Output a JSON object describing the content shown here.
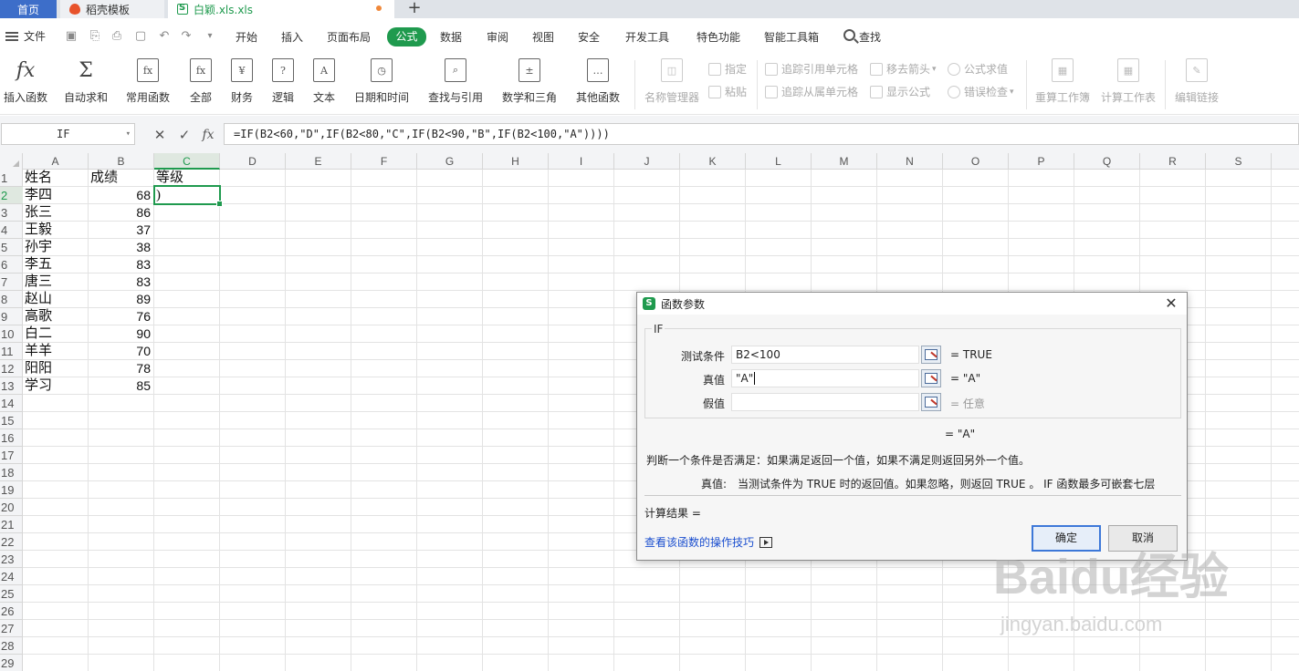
{
  "tabs": {
    "home": "首页",
    "docer": "稻壳模板",
    "file": "白颖.xls.xls",
    "add": "+"
  },
  "menu": {
    "file": "文件",
    "items": [
      "开始",
      "插入",
      "页面布局",
      "公式",
      "数据",
      "审阅",
      "视图",
      "安全",
      "开发工具",
      "特色功能",
      "智能工具箱",
      "查找"
    ],
    "active_index": 3
  },
  "ribbon": {
    "buttons": [
      "插入函数",
      "自动求和",
      "常用函数",
      "全部",
      "财务",
      "逻辑",
      "文本",
      "日期和时间",
      "查找与引用",
      "数学和三角",
      "其他函数",
      "名称管理器",
      "重算工作簿",
      "计算工作表",
      "编辑链接"
    ],
    "small": [
      "指定",
      "粘贴",
      "追踪引用单元格",
      "追踪从属单元格",
      "移去箭头",
      "显示公式",
      "公式求值",
      "错误检查"
    ],
    "icon_glyphs": {
      "insert_fn": "fx",
      "autosum": "Σ",
      "finance": "¥",
      "logic": "?",
      "text": "A"
    }
  },
  "formula_bar": {
    "name_box": "IF",
    "cancel_glyph": "✕",
    "confirm_glyph": "✓",
    "fx_glyph": "fx",
    "formula": "=IF(B2<60,\"D\",IF(B2<80,\"C\",IF(B2<90,\"B\",IF(B2<100,\"A\"))))"
  },
  "sheet": {
    "columns": [
      "A",
      "B",
      "C",
      "D",
      "E",
      "F",
      "G",
      "H",
      "I",
      "J",
      "K",
      "L",
      "M",
      "N",
      "O",
      "P",
      "Q",
      "R",
      "S"
    ],
    "selected_column": "C",
    "selected_row": 2,
    "row_numbers": [
      "1",
      "2",
      "3",
      "4",
      "5",
      "6",
      "7",
      "8",
      "9",
      "10",
      "11",
      "12",
      "13",
      "14",
      "15",
      "16",
      "17",
      "18",
      "19",
      "20",
      "21",
      "22",
      "23",
      "24",
      "25",
      "26",
      "27",
      "28",
      "29"
    ],
    "headers": {
      "a": "姓名",
      "b": "成绩",
      "c": "等级"
    },
    "rows": [
      {
        "name": "李四",
        "score": "68"
      },
      {
        "name": "张三",
        "score": "86"
      },
      {
        "name": "王毅",
        "score": "37"
      },
      {
        "name": "孙宇",
        "score": "38"
      },
      {
        "name": "李五",
        "score": "83"
      },
      {
        "name": "唐三",
        "score": "83"
      },
      {
        "name": "赵山",
        "score": "89"
      },
      {
        "name": "高歌",
        "score": "76"
      },
      {
        "name": "白二",
        "score": "90"
      },
      {
        "name": "羊羊",
        "score": "70"
      },
      {
        "name": "阳阳",
        "score": "78"
      },
      {
        "name": "学习",
        "score": "85"
      }
    ],
    "c2_value": ")"
  },
  "dialog": {
    "title": "函数参数",
    "close": "✕",
    "group_label": "IF",
    "args": [
      {
        "label": "测试条件",
        "value": "B2<100",
        "result": "= TRUE"
      },
      {
        "label": "真值",
        "value": "\"A\"",
        "result": "= \"A\""
      },
      {
        "label": "假值",
        "value": "",
        "result": "= 任意"
      }
    ],
    "overall_result": "=   \"A\"",
    "description": "判断一个条件是否满足：如果满足返回一个值，如果不满足则返回另外一个值。",
    "arg_help_label": "真值:",
    "arg_help_text": "当测试条件为 TRUE 时的返回值。如果忽略，则返回 TRUE 。 IF 函数最多可嵌套七层",
    "calc_result": "计算结果  =",
    "help_link": "查看该函数的操作技巧",
    "ok": "确定",
    "cancel": "取消"
  },
  "watermark": {
    "brand": "Baidu经验",
    "url": "jingyan.baidu.com"
  }
}
